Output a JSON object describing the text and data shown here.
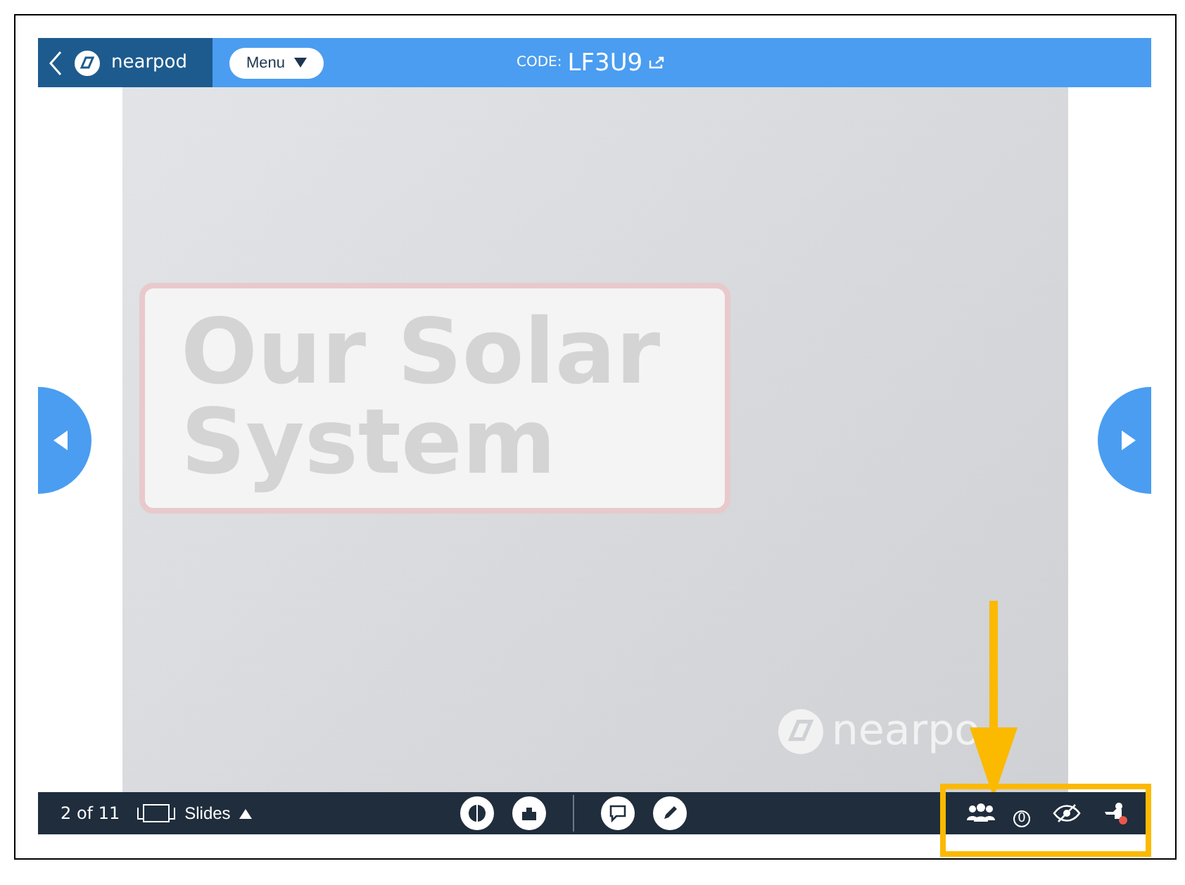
{
  "top_bar": {
    "logo": "nearpod",
    "menu_button": "Menu",
    "code_label": "CODE:",
    "code": "LF3U9"
  },
  "slide": {
    "title": "Our Solar System",
    "logo": "nearpo"
  },
  "bottom_bar": {
    "page": "2 of 11",
    "view_button": "Slides",
    "participants_count": "0"
  },
  "annotation": {
    "highlight_box": true,
    "arrow": true
  }
}
